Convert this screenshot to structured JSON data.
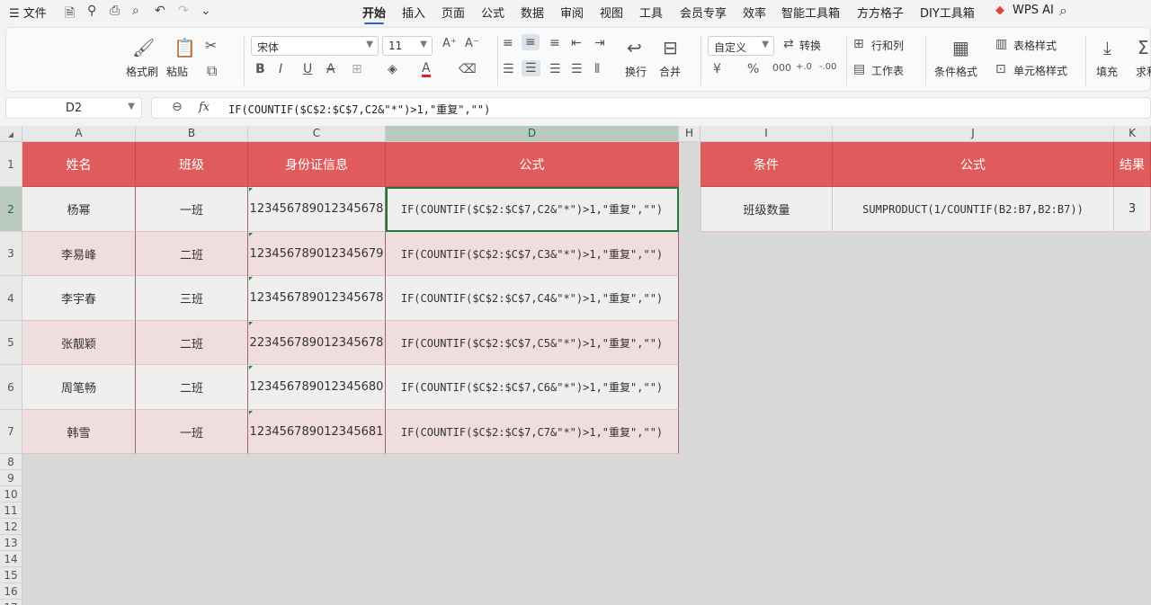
{
  "menubar": {
    "file_label": "☰ 文件",
    "tabs": [
      "开始",
      "插入",
      "页面",
      "公式",
      "数据",
      "审阅",
      "视图",
      "工具",
      "会员专享",
      "效率",
      "智能工具箱",
      "方方格子",
      "DIY工具箱"
    ],
    "active_tab": "开始",
    "wps_ai": "WPS AI"
  },
  "ribbon": {
    "format_painter": "格式刷",
    "paste": "粘贴",
    "font_name": "宋体",
    "font_size": "11",
    "number_format": "自定义",
    "convert": "转换",
    "wrap": "换行",
    "merge": "合并",
    "rows_cols": "行和列",
    "worksheet": "工作表",
    "cond_format": "条件格式",
    "table_style": "表格样式",
    "cell_style": "单元格样式",
    "fill": "填充",
    "sum": "求和"
  },
  "formula_bar": {
    "name_box": "D2",
    "fx": "fx",
    "formula": "IF(COUNTIF($C$2:$C$7,C2&\"*\")>1,\"重复\",\"\")"
  },
  "columns": [
    "A",
    "B",
    "C",
    "D",
    "H",
    "I",
    "J",
    "K"
  ],
  "row_numbers": [
    "1",
    "2",
    "3",
    "4",
    "5",
    "6",
    "7",
    "8",
    "9",
    "10",
    "11",
    "12",
    "13",
    "14",
    "15",
    "16",
    "17"
  ],
  "table1": {
    "headers": [
      "姓名",
      "班级",
      "身份证信息",
      "公式"
    ],
    "rows": [
      [
        "杨幂",
        "一班",
        "123456789012345678",
        "IF(COUNTIF($C$2:$C$7,C2&\"*\")>1,\"重复\",\"\")"
      ],
      [
        "李易峰",
        "二班",
        "123456789012345679",
        "IF(COUNTIF($C$2:$C$7,C3&\"*\")>1,\"重复\",\"\")"
      ],
      [
        "李宇春",
        "三班",
        "123456789012345678",
        "IF(COUNTIF($C$2:$C$7,C4&\"*\")>1,\"重复\",\"\")"
      ],
      [
        "张靓颖",
        "二班",
        "223456789012345678",
        "IF(COUNTIF($C$2:$C$7,C5&\"*\")>1,\"重复\",\"\")"
      ],
      [
        "周笔畅",
        "二班",
        "123456789012345680",
        "IF(COUNTIF($C$2:$C$7,C6&\"*\")>1,\"重复\",\"\")"
      ],
      [
        "韩雪",
        "一班",
        "123456789012345681",
        "IF(COUNTIF($C$2:$C$7,C7&\"*\")>1,\"重复\",\"\")"
      ]
    ]
  },
  "table2": {
    "headers": [
      "条件",
      "公式",
      "结果"
    ],
    "row": [
      "班级数量",
      "SUMPRODUCT(1/COUNTIF(B2:B7,B2:B7))",
      "3"
    ]
  },
  "colors": {
    "header_red": "#e05c5c",
    "active_green": "#1f7a3f",
    "accent_blue": "#2a63d4"
  }
}
